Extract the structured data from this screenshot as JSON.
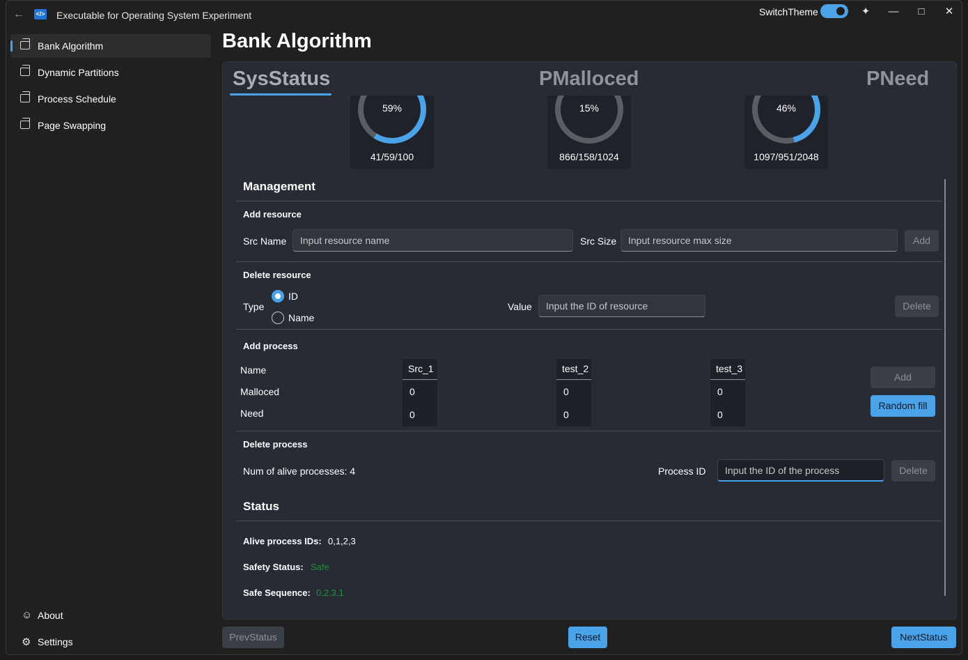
{
  "window": {
    "title": "Executable for Operating System Experiment",
    "switch_theme_label": "SwitchTheme"
  },
  "sidebar": {
    "items": [
      {
        "label": "Bank Algorithm"
      },
      {
        "label": "Dynamic Partitions"
      },
      {
        "label": "Process Schedule"
      },
      {
        "label": "Page Swapping"
      }
    ],
    "footer": [
      {
        "label": "About"
      },
      {
        "label": "Settings"
      }
    ]
  },
  "page": {
    "title": "Bank Algorithm",
    "tabs": [
      "SysStatus",
      "PMalloced",
      "PNeed"
    ]
  },
  "gauges": [
    {
      "percent": "59%",
      "ratio": "41/59/100",
      "fraction": 0.59
    },
    {
      "percent": "15%",
      "ratio": "866/158/1024",
      "fraction": 0.15
    },
    {
      "percent": "46%",
      "ratio": "1097/951/2048",
      "fraction": 0.46
    }
  ],
  "management": {
    "heading": "Management",
    "add_resource": {
      "heading": "Add resource",
      "src_name_label": "Src Name",
      "src_name_placeholder": "Input resource name",
      "src_size_label": "Src Size",
      "src_size_placeholder": "Input resource max size",
      "add_label": "Add"
    },
    "delete_resource": {
      "heading": "Delete resource",
      "type_label": "Type",
      "radio_id": "ID",
      "radio_name": "Name",
      "value_label": "Value",
      "value_placeholder": "Input the ID of resource",
      "delete_label": "Delete"
    },
    "add_process": {
      "heading": "Add process",
      "row_name": "Name",
      "row_malloced": "Malloced",
      "row_need": "Need",
      "columns": [
        {
          "name": "Src_1",
          "malloced": "0",
          "need": "0"
        },
        {
          "name": "test_2",
          "malloced": "0",
          "need": "0"
        },
        {
          "name": "test_3",
          "malloced": "0",
          "need": "0"
        }
      ],
      "add_label": "Add",
      "random_fill_label": "Random fill"
    },
    "delete_process": {
      "heading": "Delete process",
      "alive_count": "Num of alive processes: 4",
      "process_id_label": "Process ID",
      "process_id_placeholder": "Input the ID of the process",
      "delete_label": "Delete"
    }
  },
  "status": {
    "heading": "Status",
    "alive_ids_label": "Alive process IDs:",
    "alive_ids_value": "0,1,2,3",
    "safety_label": "Safety Status:",
    "safety_value": "Safe",
    "sequence_label": "Safe Sequence:",
    "sequence_value": "0,2,3,1"
  },
  "bottom": {
    "prev_label": "PrevStatus",
    "reset_label": "Reset",
    "next_label": "NextStatus"
  },
  "colors": {
    "accent": "#4aa3e8",
    "safe_green": "#1f8f3a"
  }
}
